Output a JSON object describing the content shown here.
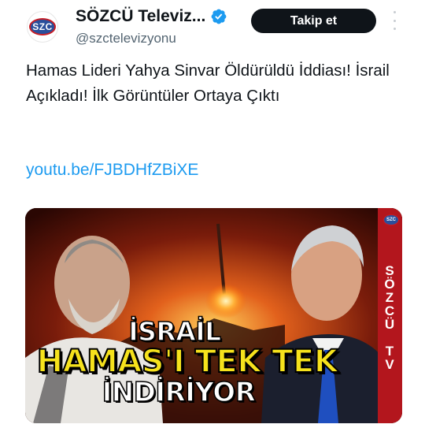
{
  "account": {
    "avatar_text": "SZC",
    "display_name": "SÖZCÜ Televiz...",
    "handle": "@szctelevizyonu",
    "verified": true,
    "follow_label": "Takip et"
  },
  "tweet": {
    "text": "Hamas Lideri Yahya Sinvar Öldürüldü İddiası! İsrail Açıkladı! İlk Görüntüler Ortaya Çıktı",
    "link": "youtu.be/FJBDHfZBiXE"
  },
  "thumbnail": {
    "line1": "İSRAİL",
    "line2": "HAMAS'I TEK TEK",
    "line3": "İNDİRİYOR",
    "brand_vertical": "SÖZCÜ TV",
    "brand_logo": "SZC"
  },
  "colors": {
    "follow_bg": "#0f1419",
    "link": "#1d9bf0",
    "verified": "#1d9bf0",
    "headline_yellow": "#f6e21c",
    "brand_red": "#c81d25"
  },
  "icons": [
    "verified-badge-icon",
    "more-options-icon"
  ]
}
